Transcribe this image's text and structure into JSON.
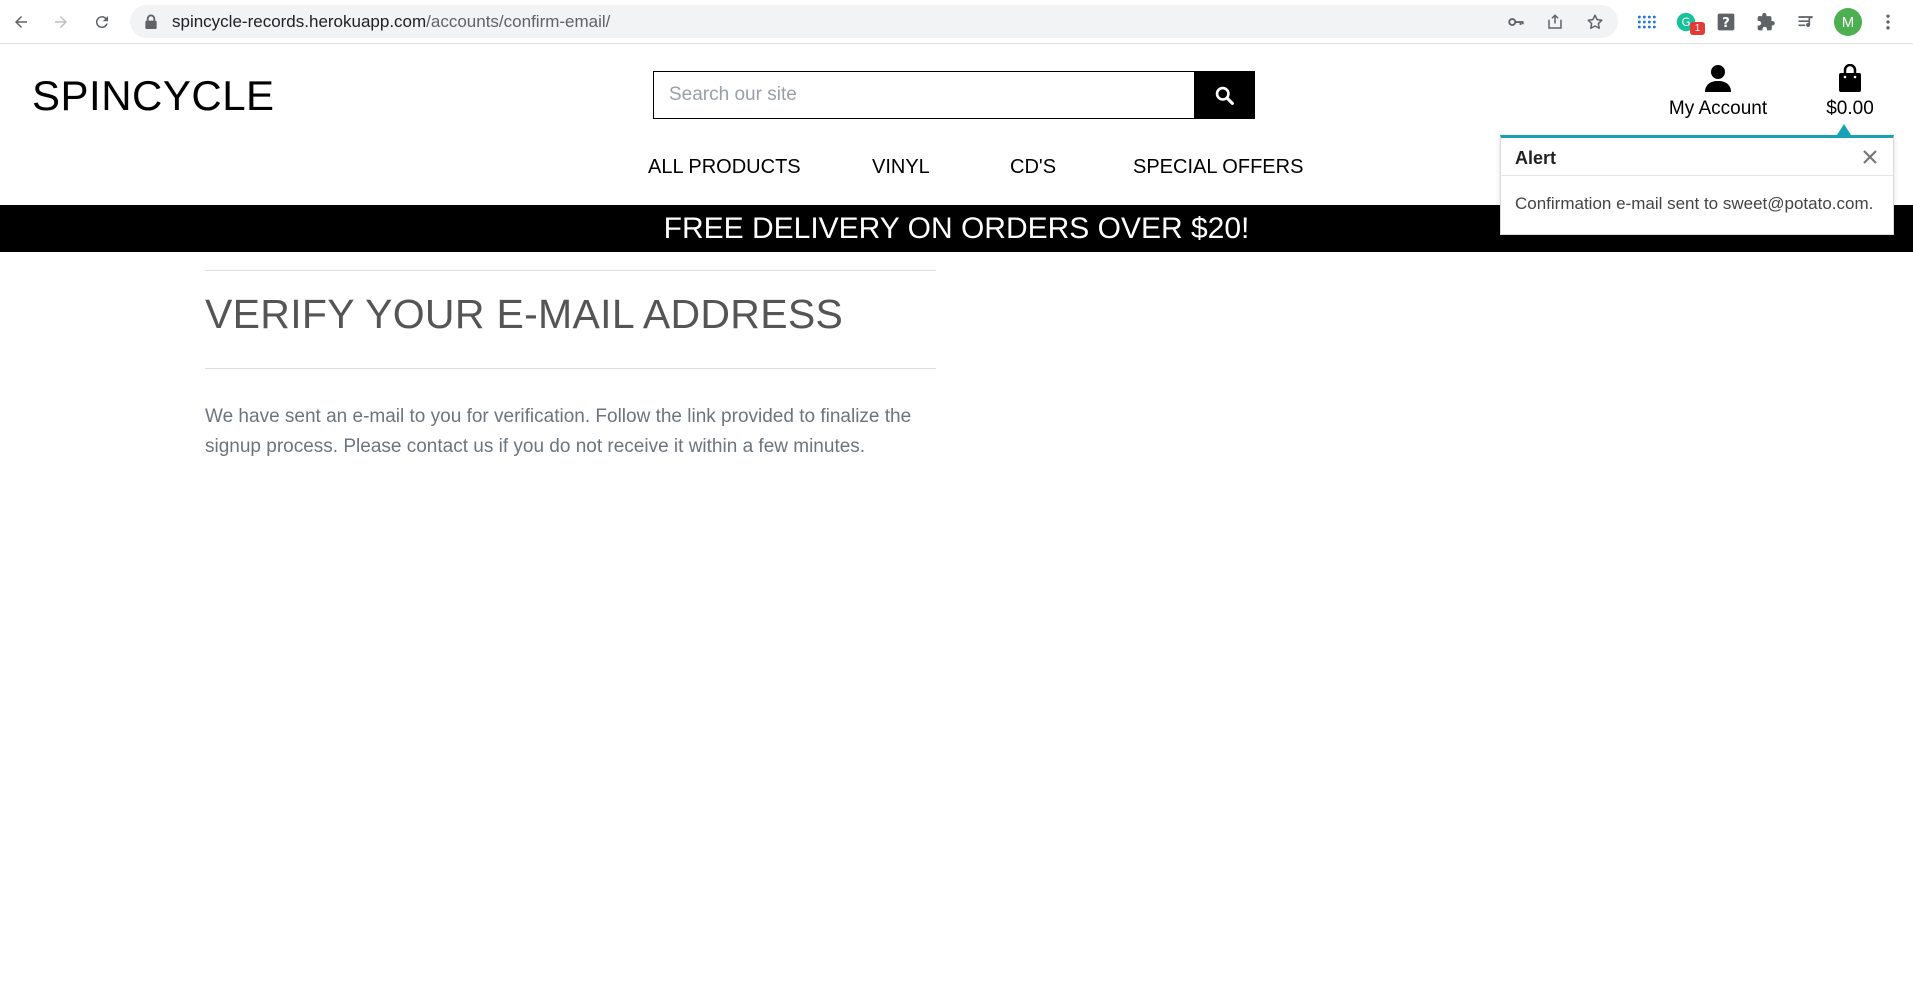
{
  "browser": {
    "url_domain": "spincycle-records.herokuapp.com",
    "url_path": "/accounts/confirm-email/",
    "extension_badge": "1",
    "profile_initial": "M",
    "icons": [
      "back-icon",
      "forward-icon",
      "reload-icon",
      "lock-icon",
      "key-icon",
      "share-icon",
      "star-icon",
      "apps-grid-icon",
      "grammarly-icon",
      "help-icon",
      "puzzle-icon",
      "media-icon",
      "menu-icon"
    ]
  },
  "header": {
    "logo": "SPINCYCLE",
    "search_placeholder": "Search our site",
    "account_label": "My Account",
    "bag_total": "$0.00"
  },
  "nav": {
    "items": [
      "ALL PRODUCTS",
      "VINYL",
      "CD'S",
      "SPECIAL OFFERS"
    ]
  },
  "banner": {
    "text": "FREE DELIVERY ON ORDERS OVER $20!"
  },
  "toast": {
    "title": "Alert",
    "message": "Confirmation e-mail sent to sweet@potato.com.",
    "accent": "#17a2b8"
  },
  "main": {
    "title": "VERIFY YOUR E-MAIL ADDRESS",
    "text": "We have sent an e-mail to you for verification. Follow the link provided to finalize the signup process. Please contact us if you do not receive it within a few minutes."
  },
  "colors": {
    "banner_bg": "#000000",
    "avatar_bg": "#4caf50",
    "badge_bg": "#e53935"
  }
}
